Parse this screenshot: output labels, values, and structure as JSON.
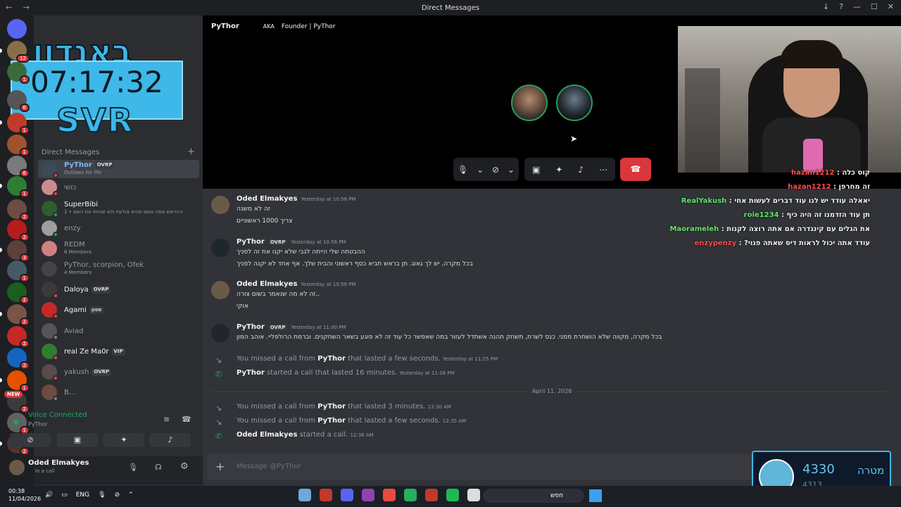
{
  "window": {
    "title": "Direct Messages"
  },
  "overlay": {
    "clock": "07:17:32",
    "logo_text": "SVR",
    "logo_hebrew": "באנדוו"
  },
  "sidebar": {
    "badges": [
      "12",
      "1",
      "6",
      "1",
      "1",
      "6",
      "1",
      "2",
      "2",
      "3",
      "1",
      "2",
      "2",
      "2",
      "2",
      "1",
      "2",
      "1",
      "2"
    ],
    "new_label": "NEW",
    "dm_header": "Direct Messages",
    "dms": [
      {
        "name": "PyThor",
        "tag": "OVRP",
        "sub": "Outlaws for life"
      },
      {
        "name": "כושי",
        "tag": "",
        "sub": ""
      },
      {
        "name": "SuperBibi",
        "tag": "",
        "sub": "הראש אתה אשם שהיא צולעת ולא שכחת את השם • 1+"
      },
      {
        "name": "enzy",
        "tag": "",
        "sub": ""
      },
      {
        "name": "REDM",
        "tag": "",
        "sub": "6 Members"
      },
      {
        "name": "PyThor, scorpion, Ofek",
        "tag": "",
        "sub": "4 Members"
      },
      {
        "name": "Daloya",
        "tag": "OVRP",
        "sub": ""
      },
      {
        "name": "Agami",
        "tag": "סטון",
        "sub": ""
      },
      {
        "name": "Aviad",
        "tag": "",
        "sub": ""
      },
      {
        "name": "real Ze Ma0r",
        "tag": "VIP",
        "sub": ""
      },
      {
        "name": "yakush",
        "tag": "OVRP",
        "sub": ""
      },
      {
        "name": "B...",
        "tag": "",
        "sub": ""
      }
    ],
    "voice": {
      "status": "Voice Connected",
      "channel": "PyThor"
    },
    "user": {
      "name": "Oded Elmakyes",
      "status": "In a call"
    }
  },
  "call": {
    "name": "PyThor",
    "aka": "AKA",
    "subtitle": "Founder | PyThor"
  },
  "chat_overlay": [
    {
      "user": "hazan1212",
      "text": "קוס כלה"
    },
    {
      "user": "hazan1212",
      "text": "זה מחרפן"
    },
    {
      "user": "RealYakush",
      "text": "יאאלה עודד יש לנו עוד דברים לעשות אחי"
    },
    {
      "user": "roie1234",
      "text": "תן עוד הזדמנו זה היה כיף"
    },
    {
      "user": "Maorameleh",
      "text": "את הגלים עם קינגדרה אם אתה רוצה לקנות"
    },
    {
      "user": "enzypenzy",
      "text": "עודד אתה יכול לראות דיס שאתה פנוי?"
    }
  ],
  "messages": [
    {
      "author": "Oded Elmakyes",
      "tag": "",
      "time": "Yesterday at 10:56 PM",
      "lines": [
        "זה לא משנה",
        "צריך 1000 ראשוניים"
      ]
    },
    {
      "author": "PyThor",
      "tag": "OVRP",
      "time": "Yesterday at 10:56 PM",
      "lines": [
        "ההבטחה שלי הייתה לגבי שלא יקנו את זה לפניך",
        "בכל מקרה, יש לך גאוג. תן בראש תביא כסף ראשוני והבית שלך. אף אחד לא יקנה לפניך"
      ]
    },
    {
      "author": "Oded Elmakyes",
      "tag": "",
      "time": "Yesterday at 10:56 PM",
      "lines": [
        "זה לא מה שנאמר בשום צורה..",
        "אוקי"
      ]
    },
    {
      "author": "PyThor",
      "tag": "OVRP",
      "time": "Yesterday at 11:00 PM",
      "lines": [
        "בכל מקרה, מקווה שלא הושחרת ממני. כנס לשרת, תשחק תהנה אשתדל לעזור במה שאפשר כל עוד זה לא פוגע בשאר השחקנים. וברמת הרולפליי. אוהב המון"
      ]
    }
  ],
  "system_messages": [
    {
      "pre": "You missed a call from",
      "who": "PyThor",
      "post": "that lasted a few seconds.",
      "time": "Yesterday at 11:25 PM",
      "kind": "missed"
    },
    {
      "pre": "",
      "who": "PyThor",
      "post": "started a call that lasted 16 minutes.",
      "time": "Yesterday at 11:26 PM",
      "kind": "started"
    },
    {
      "pre": "You missed a call from",
      "who": "PyThor",
      "post": "that lasted 3 minutes.",
      "time": "12:30 AM",
      "kind": "missed"
    },
    {
      "pre": "You missed a call from",
      "who": "PyThor",
      "post": "that lasted a few seconds.",
      "time": "12:35 AM",
      "kind": "missed"
    },
    {
      "pre": "",
      "who": "Oded Elmakyes",
      "post": "started a call.",
      "time": "12:36 AM",
      "kind": "started"
    }
  ],
  "date_divider": "April 11, 2026",
  "composer": {
    "placeholder": "Message @PyThor"
  },
  "goal_widget": {
    "value": "4330",
    "label": "מטרה",
    "sub": "4313"
  },
  "taskbar": {
    "time": "00:38",
    "date": "11/04/2026",
    "lang": "ENG",
    "search": "חפש"
  }
}
